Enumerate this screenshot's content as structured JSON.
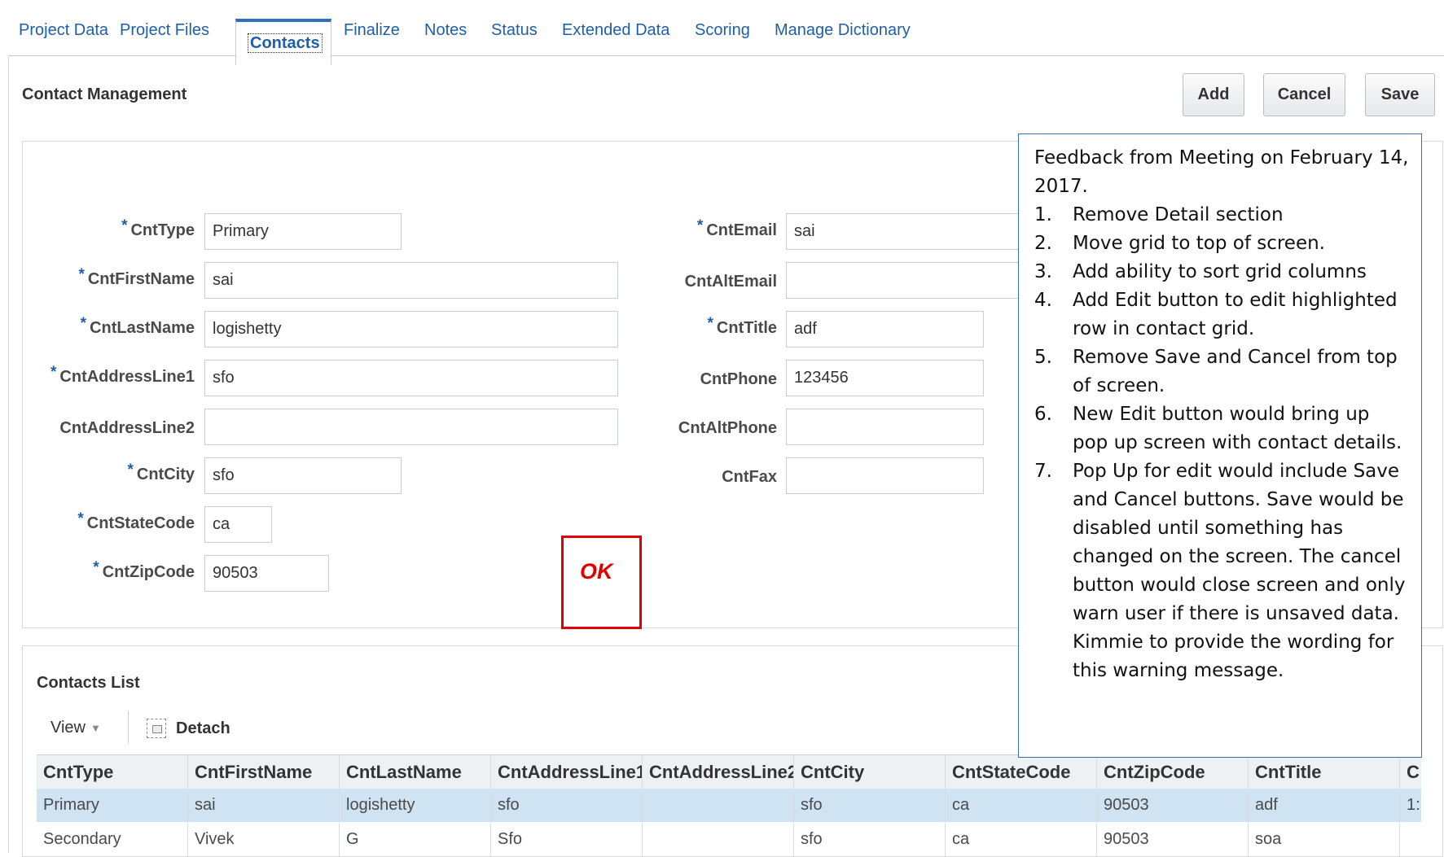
{
  "tabs": [
    {
      "label": "Project Data"
    },
    {
      "label": "Project Files"
    },
    {
      "label": "Contacts",
      "active": true
    },
    {
      "label": "Finalize"
    },
    {
      "label": "Notes"
    },
    {
      "label": "Status"
    },
    {
      "label": "Extended Data"
    },
    {
      "label": "Scoring"
    },
    {
      "label": "Manage Dictionary"
    }
  ],
  "header": {
    "title": "Contact Management",
    "add_label": "Add",
    "cancel_label": "Cancel",
    "save_label": "Save"
  },
  "form": {
    "required_marker": "*",
    "left": [
      {
        "label": "CntType",
        "value": "Primary",
        "required": true
      },
      {
        "label": "CntFirstName",
        "value": "sai",
        "required": true
      },
      {
        "label": "CntLastName",
        "value": "logishetty",
        "required": true
      },
      {
        "label": "CntAddressLine1",
        "value": "sfo",
        "required": true
      },
      {
        "label": "CntAddressLine2",
        "value": "",
        "required": false
      },
      {
        "label": "CntCity",
        "value": "sfo",
        "required": true
      },
      {
        "label": "CntStateCode",
        "value": "ca",
        "required": true
      },
      {
        "label": "CntZipCode",
        "value": "90503",
        "required": true
      }
    ],
    "right": [
      {
        "label": "CntEmail",
        "value": "sai",
        "required": true
      },
      {
        "label": "CntAltEmail",
        "value": "",
        "required": false
      },
      {
        "label": "CntTitle",
        "value": "adf",
        "required": true
      },
      {
        "label": "CntPhone",
        "value": "123456",
        "required": false
      },
      {
        "label": "CntAltPhone",
        "value": "",
        "required": false
      },
      {
        "label": "CntFax",
        "value": "",
        "required": false
      }
    ]
  },
  "annotation": {
    "ok_text": "OK",
    "color": "#e10000"
  },
  "contacts_list": {
    "title": "Contacts List",
    "view_label": "View",
    "detach_label": "Detach",
    "columns": [
      "CntType",
      "CntFirstName",
      "CntLastName",
      "CntAddressLine1",
      "CntAddressLine2",
      "CntCity",
      "CntStateCode",
      "CntZipCode",
      "CntTitle",
      "C"
    ],
    "rows": [
      [
        "Primary",
        "sai",
        "logishetty",
        "sfo",
        "",
        "sfo",
        "ca",
        "90503",
        "adf",
        "1:"
      ],
      [
        "Secondary",
        "Vivek",
        "G",
        "Sfo",
        "",
        "sfo",
        "ca",
        "90503",
        "soa",
        ""
      ]
    ]
  },
  "feedback_note": {
    "heading": "Feedback from Meeting on February 14, 2017.",
    "items": [
      {
        "num": "1.",
        "text": "Remove Detail section"
      },
      {
        "num": "2.",
        "text": "Move grid to top of screen."
      },
      {
        "num": "3.",
        "text": "Add ability to sort grid columns"
      },
      {
        "num": "4.",
        "text": "Add Edit button to edit highlighted row in contact grid."
      },
      {
        "num": "5.",
        "text": "Remove Save and Cancel from top of  screen."
      },
      {
        "num": "6.",
        "text": "New Edit button would bring up pop up screen with contact details."
      },
      {
        "num": "7.",
        "text": "Pop Up for edit would include Save and Cancel buttons.  Save would be disabled until something has changed on the screen.  The cancel button would close screen and only warn user if there is unsaved data.  Kimmie to provide the wording for this warning message."
      }
    ]
  },
  "colors": {
    "accent": "#1f5fa8",
    "selected_row": "#cfe3f2",
    "note_border": "#3b6fb5"
  }
}
